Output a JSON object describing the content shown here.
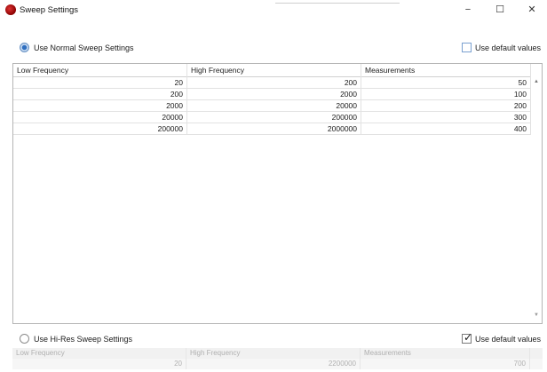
{
  "window": {
    "title": "Sweep Settings",
    "minimize": "−",
    "maximize": "☐",
    "close": "✕"
  },
  "normal": {
    "radio_label": "Use Normal Sweep Settings",
    "default_label": "Use default values",
    "columns": [
      "Low Frequency",
      "High Frequency",
      "Measurements"
    ],
    "rows": [
      [
        "20",
        "200",
        "50"
      ],
      [
        "200",
        "2000",
        "100"
      ],
      [
        "2000",
        "20000",
        "200"
      ],
      [
        "20000",
        "200000",
        "300"
      ],
      [
        "200000",
        "2000000",
        "400"
      ]
    ]
  },
  "hires": {
    "radio_label": "Use Hi-Res Sweep Settings",
    "default_label": "Use default values",
    "columns": [
      "Low Frequency",
      "High Frequency",
      "Measurements"
    ],
    "row": [
      "20",
      "2200000",
      "700"
    ]
  }
}
